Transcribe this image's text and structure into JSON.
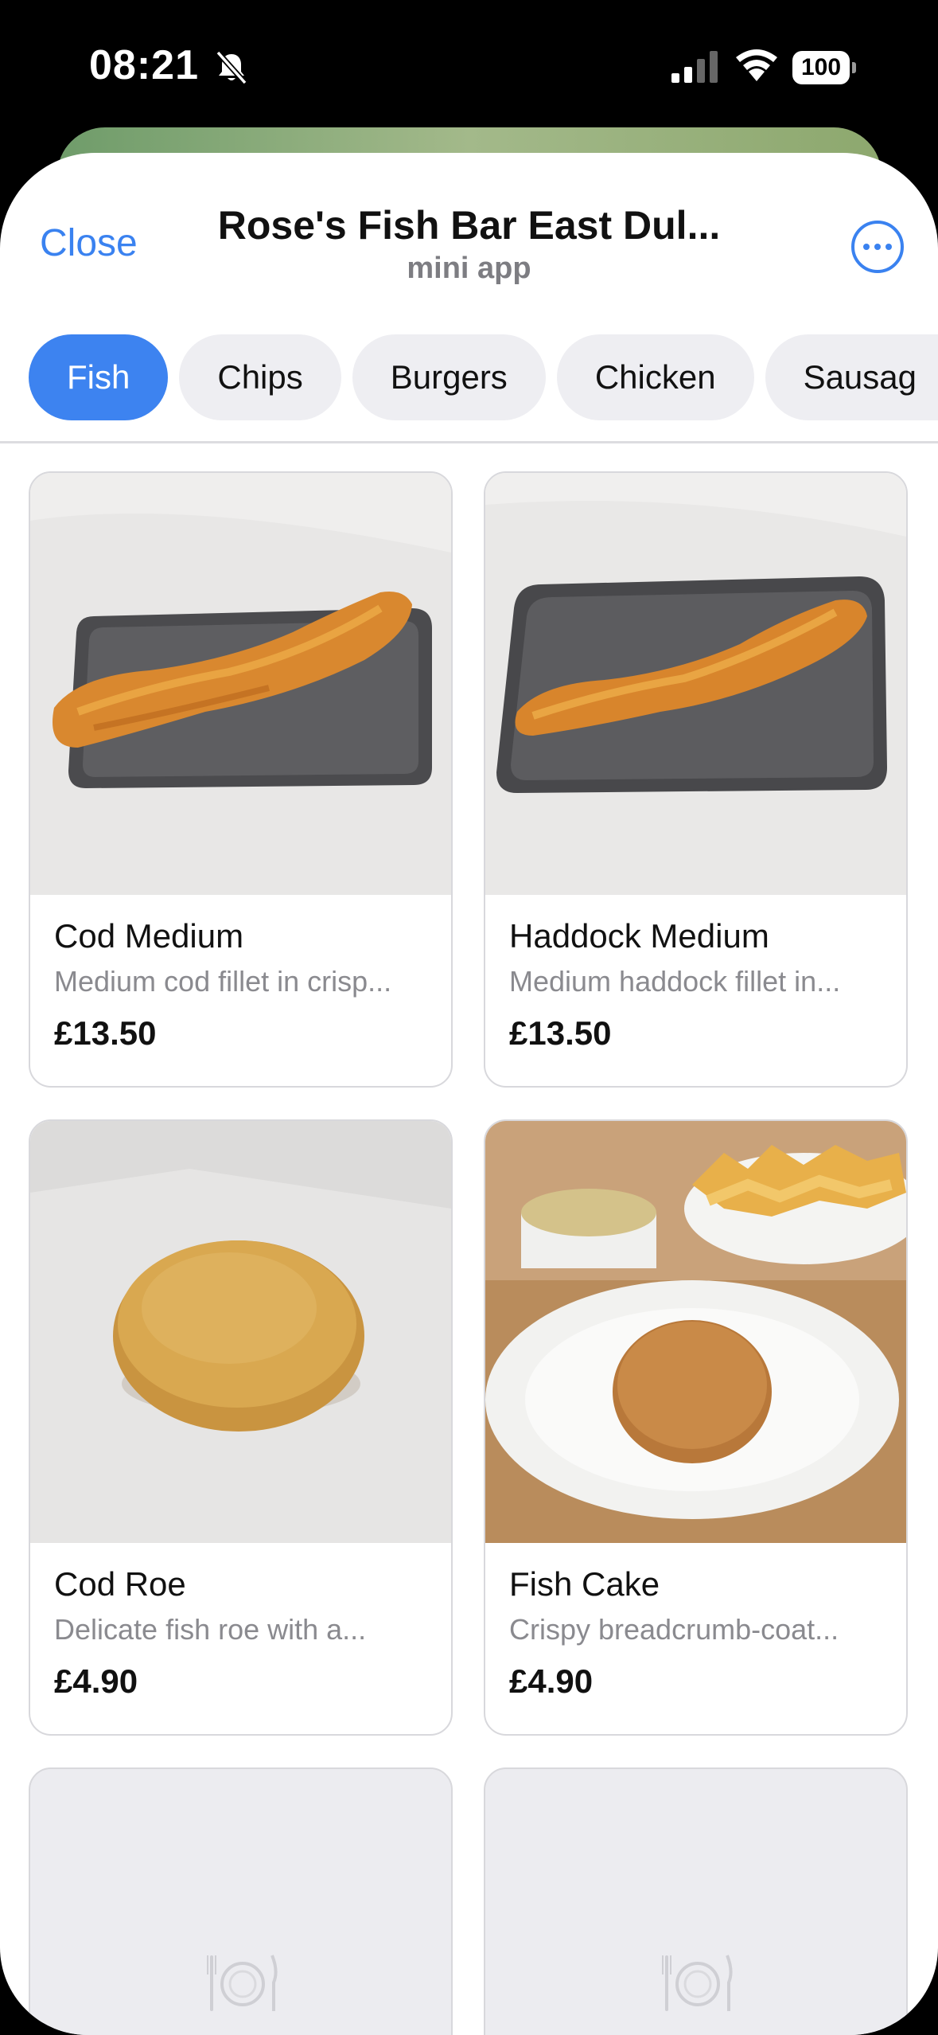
{
  "status": {
    "time": "08:21",
    "battery": "100"
  },
  "header": {
    "close_label": "Close",
    "title": "Rose's Fish Bar East Dul...",
    "subtitle": "mini app"
  },
  "tabs": [
    {
      "label": "Fish",
      "active": true
    },
    {
      "label": "Chips",
      "active": false
    },
    {
      "label": "Burgers",
      "active": false
    },
    {
      "label": "Chicken",
      "active": false
    },
    {
      "label": "Sausag",
      "active": false
    }
  ],
  "products": [
    {
      "name": "Cod Medium",
      "description": "Medium cod fillet in crisp...",
      "price": "£13.50"
    },
    {
      "name": "Haddock Medium",
      "description": "Medium haddock fillet in...",
      "price": "£13.50"
    },
    {
      "name": "Cod Roe",
      "description": "Delicate fish roe with a...",
      "price": "£4.90"
    },
    {
      "name": "Fish Cake",
      "description": "Crispy breadcrumb-coat...",
      "price": "£4.90"
    }
  ],
  "colors": {
    "accent": "#3a82f0",
    "tab_inactive": "#eeeef2"
  }
}
